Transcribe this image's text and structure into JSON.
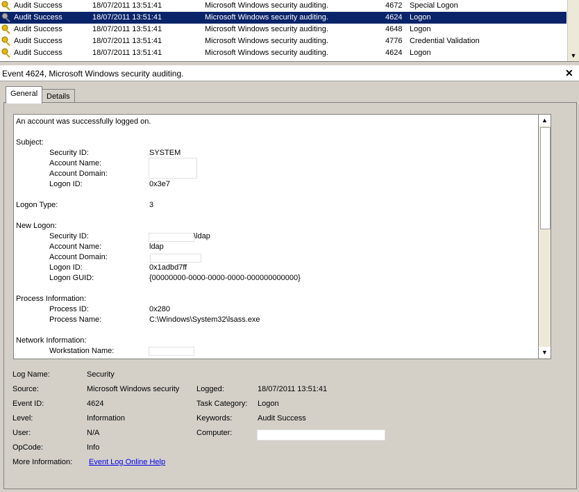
{
  "events": [
    {
      "keywords": "Audit Success",
      "date": "18/07/2011 13:51:41",
      "source": "Microsoft Windows security auditing.",
      "event_id": "4672",
      "task": "Special Logon",
      "selected": false
    },
    {
      "keywords": "Audit Success",
      "date": "18/07/2011 13:51:41",
      "source": "Microsoft Windows security auditing.",
      "event_id": "4624",
      "task": "Logon",
      "selected": true
    },
    {
      "keywords": "Audit Success",
      "date": "18/07/2011 13:51:41",
      "source": "Microsoft Windows security auditing.",
      "event_id": "4648",
      "task": "Logon",
      "selected": false
    },
    {
      "keywords": "Audit Success",
      "date": "18/07/2011 13:51:41",
      "source": "Microsoft Windows security auditing.",
      "event_id": "4776",
      "task": "Credential Validation",
      "selected": false
    },
    {
      "keywords": "Audit Success",
      "date": "18/07/2011 13:51:41",
      "source": "Microsoft Windows security auditing.",
      "event_id": "4624",
      "task": "Logon",
      "selected": false
    }
  ],
  "event_header": "Event 4624, Microsoft Windows security auditing.",
  "tabs": {
    "general": "General",
    "details": "Details"
  },
  "description": {
    "intro": "An account was successfully logged on.",
    "subject": "Subject:",
    "subject_security_id_label": "Security ID:",
    "subject_security_id": "SYSTEM",
    "subject_account_name_label": "Account Name:",
    "subject_account_domain_label": "Account Domain:",
    "subject_logon_id_label": "Logon ID:",
    "subject_logon_id": "0x3e7",
    "logon_type_label": "Logon Type:",
    "logon_type": "3",
    "new_logon": "New Logon:",
    "new_security_id_label": "Security ID:",
    "new_security_id_suffix": "\\ldap",
    "new_account_name_label": "Account Name:",
    "new_account_name": "ldap",
    "new_account_domain_label": "Account Domain:",
    "new_logon_id_label": "Logon ID:",
    "new_logon_id": "0x1adbd7ff",
    "new_logon_guid_label": "Logon GUID:",
    "new_logon_guid": "{00000000-0000-0000-0000-000000000000}",
    "process_info": "Process Information:",
    "process_id_label": "Process ID:",
    "process_id": "0x280",
    "process_name_label": "Process Name:",
    "process_name": "C:\\Windows\\System32\\lsass.exe",
    "network_info": "Network Information:",
    "workstation_name_label": "Workstation Name:"
  },
  "properties": {
    "log_name_label": "Log Name:",
    "log_name": "Security",
    "source_label": "Source:",
    "source": "Microsoft Windows security",
    "logged_label": "Logged:",
    "logged": "18/07/2011 13:51:41",
    "event_id_label": "Event ID:",
    "event_id": "4624",
    "task_category_label": "Task Category:",
    "task_category": "Logon",
    "level_label": "Level:",
    "level": "Information",
    "keywords_label": "Keywords:",
    "keywords": "Audit Success",
    "user_label": "User:",
    "user": "N/A",
    "computer_label": "Computer:",
    "opcode_label": "OpCode:",
    "opcode": "Info",
    "more_info_label": "More Information:",
    "more_info_link": "Event Log Online Help"
  },
  "colors": {
    "selection": "#0a246a",
    "link": "#0000ee",
    "background": "#d4d0c8"
  },
  "icons": {
    "row_icon": "key-icon",
    "close": "close-icon"
  }
}
